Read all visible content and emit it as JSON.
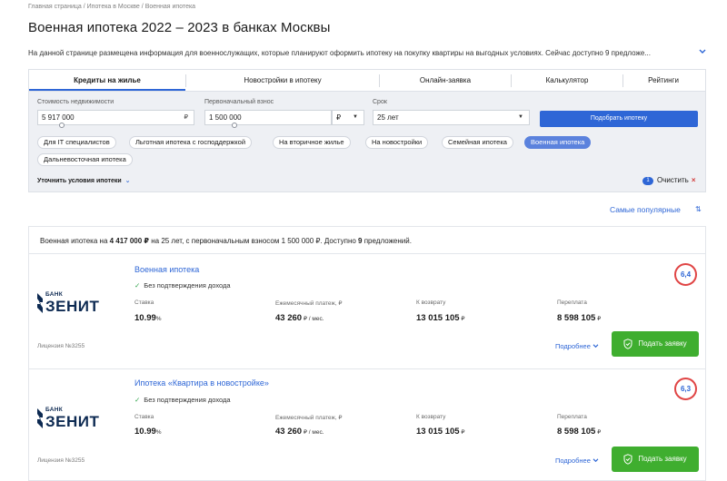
{
  "breadcrumbs": {
    "home": "Главная страница",
    "mortgage": "Ипотека в Москве",
    "current": "Военная ипотека",
    "sep": "/"
  },
  "page_title": "Военная ипотека 2022 – 2023 в банках Москвы",
  "intro_text": "На данной странице размещена информация для военнослужащих, которые планируют оформить ипотеку на покупку квартиры на выгодных условиях. Сейчас доступно 9 предложе...",
  "tabs": [
    {
      "label": "Кредиты на жилье"
    },
    {
      "label": "Новостройки в ипотеку"
    },
    {
      "label": "Онлайн-заявка"
    },
    {
      "label": "Калькулятор"
    },
    {
      "label": "Рейтинги"
    }
  ],
  "filters": {
    "price": {
      "label": "Стоимость недвижимости",
      "value": "5 917 000",
      "suffix": "₽"
    },
    "down_payment": {
      "label": "Первоначальный взнос",
      "value": "1 500 000",
      "suffix": "₽"
    },
    "term": {
      "label": "Срок",
      "value": "25 лет"
    },
    "currency_arrow": "▼",
    "term_arrow": "▼",
    "match_button": "Подобрать ипотеку",
    "chips": [
      "Для IT специалистов",
      "Льготная ипотека с господдержкой",
      "На вторичное жилье",
      "На новостройки",
      "Семейная ипотека",
      "Военная ипотека",
      "Дальневосточная ипотека"
    ],
    "refine_label": "Уточнить условия ипотеки",
    "refine_chevron": "⌄",
    "active_count": "1",
    "clear_label": "Очистить",
    "clear_x": "×"
  },
  "sort": {
    "label": "Самые популярные",
    "icon": "⇅"
  },
  "summary": {
    "p1": "Военная ипотека на ",
    "amount": "4 417 000 ₽",
    "p2": " на 25 лет, с первоначальным взносом 1 500 000 ₽. Доступно ",
    "count": "9",
    "p3": " предложений."
  },
  "offers": [
    {
      "title": "Военная ипотека",
      "no_income": "Без подтверждения дохода",
      "bank_small": "БАНК",
      "bank_big": "ЗЕНИТ",
      "rate_label": "Ставка",
      "rate_value": "10.99",
      "rate_unit": "%",
      "monthly_label": "Ежемесячный платеж, ₽",
      "monthly_value": "43 260",
      "monthly_unit": " ₽ / мес.",
      "return_label": "К возврату",
      "return_value": "13 015 105",
      "return_unit": " ₽",
      "overpay_label": "Переплата",
      "overpay_value": "8 598 105",
      "overpay_unit": " ₽",
      "license": "Лицензия №3255",
      "rating": "6,4",
      "more": "Подробнее",
      "apply": "Подать заявку"
    },
    {
      "title": "Ипотека «Квартира в новостройке»",
      "no_income": "Без подтверждения дохода",
      "bank_small": "БАНК",
      "bank_big": "ЗЕНИТ",
      "rate_label": "Ставка",
      "rate_value": "10.99",
      "rate_unit": "%",
      "monthly_label": "Ежемесячный платеж, ₽",
      "monthly_value": "43 260",
      "monthly_unit": " ₽ / мес.",
      "return_label": "К возврату",
      "return_value": "13 015 105",
      "return_unit": " ₽",
      "overpay_label": "Переплата",
      "overpay_value": "8 598 105",
      "overpay_unit": " ₽",
      "license": "Лицензия №3255",
      "rating": "6,3",
      "more": "Подробнее",
      "apply": "Подать заявку"
    }
  ],
  "colors": {
    "accent": "#2e66d6",
    "apply": "#3fae2f",
    "rating_ring": "#e04545",
    "bank": "#0d2a52"
  }
}
